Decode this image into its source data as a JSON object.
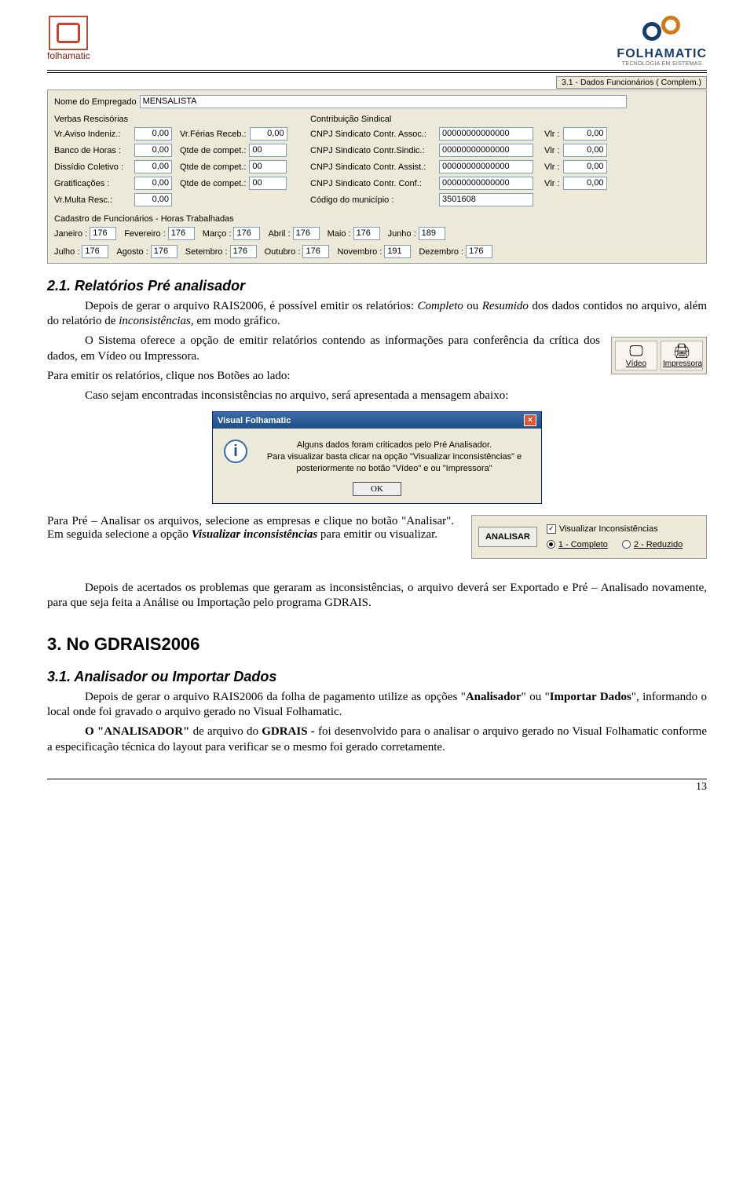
{
  "header": {
    "left_brand": "folhamatic",
    "right_brand": "FOLHAMATIC",
    "right_tagline": "TECNOLOGIA EM SISTEMAS"
  },
  "window": {
    "title": "3.1 - Dados Funcionários ( Complem.)",
    "nome_label": "Nome do Empregado",
    "nome_value": "MENSALISTA",
    "verbas_title": "Verbas Rescisórias",
    "sindical_title": "Contribuição Sindical",
    "left": [
      {
        "label": "Vr.Aviso Indeniz.:",
        "value": "0,00",
        "rlabel": "Vr.Férias Receb.:",
        "rvalue": "0,00"
      },
      {
        "label": "Banco de Horas :",
        "value": "0,00",
        "rlabel": "Qtde de compet.:",
        "rvalue": "00"
      },
      {
        "label": "Dissídio Coletivo :",
        "value": "0,00",
        "rlabel": "Qtde de compet.:",
        "rvalue": "00"
      },
      {
        "label": "Gratificações :",
        "value": "0,00",
        "rlabel": "Qtde de compet.:",
        "rvalue": "00"
      },
      {
        "label": "Vr.Multa Resc.:",
        "value": "0,00",
        "rlabel": "",
        "rvalue": ""
      }
    ],
    "right": [
      {
        "label": "CNPJ Sindicato Contr. Assoc.:",
        "value": "00000000000000",
        "vlr": "0,00"
      },
      {
        "label": "CNPJ Sindicato Contr.Sindic.:",
        "value": "00000000000000",
        "vlr": "0,00"
      },
      {
        "label": "CNPJ Sindicato Contr. Assist.:",
        "value": "00000000000000",
        "vlr": "0,00"
      },
      {
        "label": "CNPJ Sindicato Contr. Conf.:",
        "value": "00000000000000",
        "vlr": "0,00"
      }
    ],
    "vlr_label": "Vlr :",
    "codigo_mun_label": "Código do município :",
    "codigo_mun_value": "3501608",
    "horas_title": "Cadastro de Funcionários - Horas Trabalhadas",
    "months": [
      {
        "label": "Janeiro :",
        "value": "176"
      },
      {
        "label": "Fevereiro :",
        "value": "176"
      },
      {
        "label": "Março :",
        "value": "176"
      },
      {
        "label": "Abril :",
        "value": "176"
      },
      {
        "label": "Maio :",
        "value": "176"
      },
      {
        "label": "Junho :",
        "value": "189"
      },
      {
        "label": "Julho :",
        "value": "176"
      },
      {
        "label": "Agosto :",
        "value": "176"
      },
      {
        "label": "Setembro :",
        "value": "176"
      },
      {
        "label": "Outubro :",
        "value": "176"
      },
      {
        "label": "Novembro :",
        "value": "191"
      },
      {
        "label": "Dezembro :",
        "value": "176"
      }
    ]
  },
  "sec21_title": "2.1. Relatórios Pré analisador",
  "p1a": "Depois de gerar o arquivo RAIS2006, é possível emitir os relatórios: ",
  "p1b": "Completo",
  "p1c": " ou ",
  "p1d": "Resumido",
  "p1e": " dos dados contidos no arquivo, além do relatório de ",
  "p1f": "inconsistências",
  "p1g": ", em modo gráfico.",
  "p2": "O Sistema oferece a opção de emitir relatórios contendo as informações para conferência da crítica dos dados, em Vídeo ou Impressora.",
  "p3": "Para emitir os relatórios, clique nos Botões ao lado:",
  "p4": "Caso sejam encontradas inconsistências no arquivo, será apresentada a mensagem abaixo:",
  "btn_video": "Vídeo",
  "btn_impressora": "Impressora",
  "dialog": {
    "title": "Visual Folhamatic",
    "line1": "Alguns dados foram criticados pelo Pré Analisador.",
    "line2": "Para visualizar basta clicar na opção \"Visualizar inconsistências\" e",
    "line3": "posteriormente no botão \"Vídeo\" e ou \"Impressora\"",
    "ok": "OK"
  },
  "p5a": "Para Pré – Analisar os arquivos, selecione as empresas e clique no botão \"Analisar\". Em seguida selecione a opção ",
  "p5b": "Visualizar inconsistências",
  "p5c": " para emitir ou visualizar.",
  "opts": {
    "analisar": "ANALISAR",
    "check_label": "Visualizar Inconsistências",
    "check_value": "✓",
    "r1": "1 - Completo",
    "r2": "2 - Reduzido"
  },
  "p6": "Depois de acertados os problemas que geraram as inconsistências, o arquivo deverá ser Exportado e Pré – Analisado novamente, para que seja feita a Análise ou Importação pelo programa GDRAIS.",
  "sec3_title": "3. No GDRAIS2006",
  "sec31_title": "3.1. Analisador ou Importar Dados",
  "p7a": "Depois de gerar o arquivo RAIS2006 da folha de pagamento utilize as opções \"",
  "p7b": "Analisador",
  "p7c": "\" ou \"",
  "p7d": "Importar Dados",
  "p7e": "\", informando o local onde foi gravado o arquivo gerado no Visual Folhamatic.",
  "p8a": "O \"ANALISADOR\"",
  "p8b": " de arquivo do ",
  "p8c": "GDRAIS - ",
  "p8d": "foi desenvolvido para o analisar o arquivo gerado no Visual Folhamatic conforme a especificação técnica do layout para verificar se o mesmo foi gerado corretamente.",
  "pagenum": "13"
}
